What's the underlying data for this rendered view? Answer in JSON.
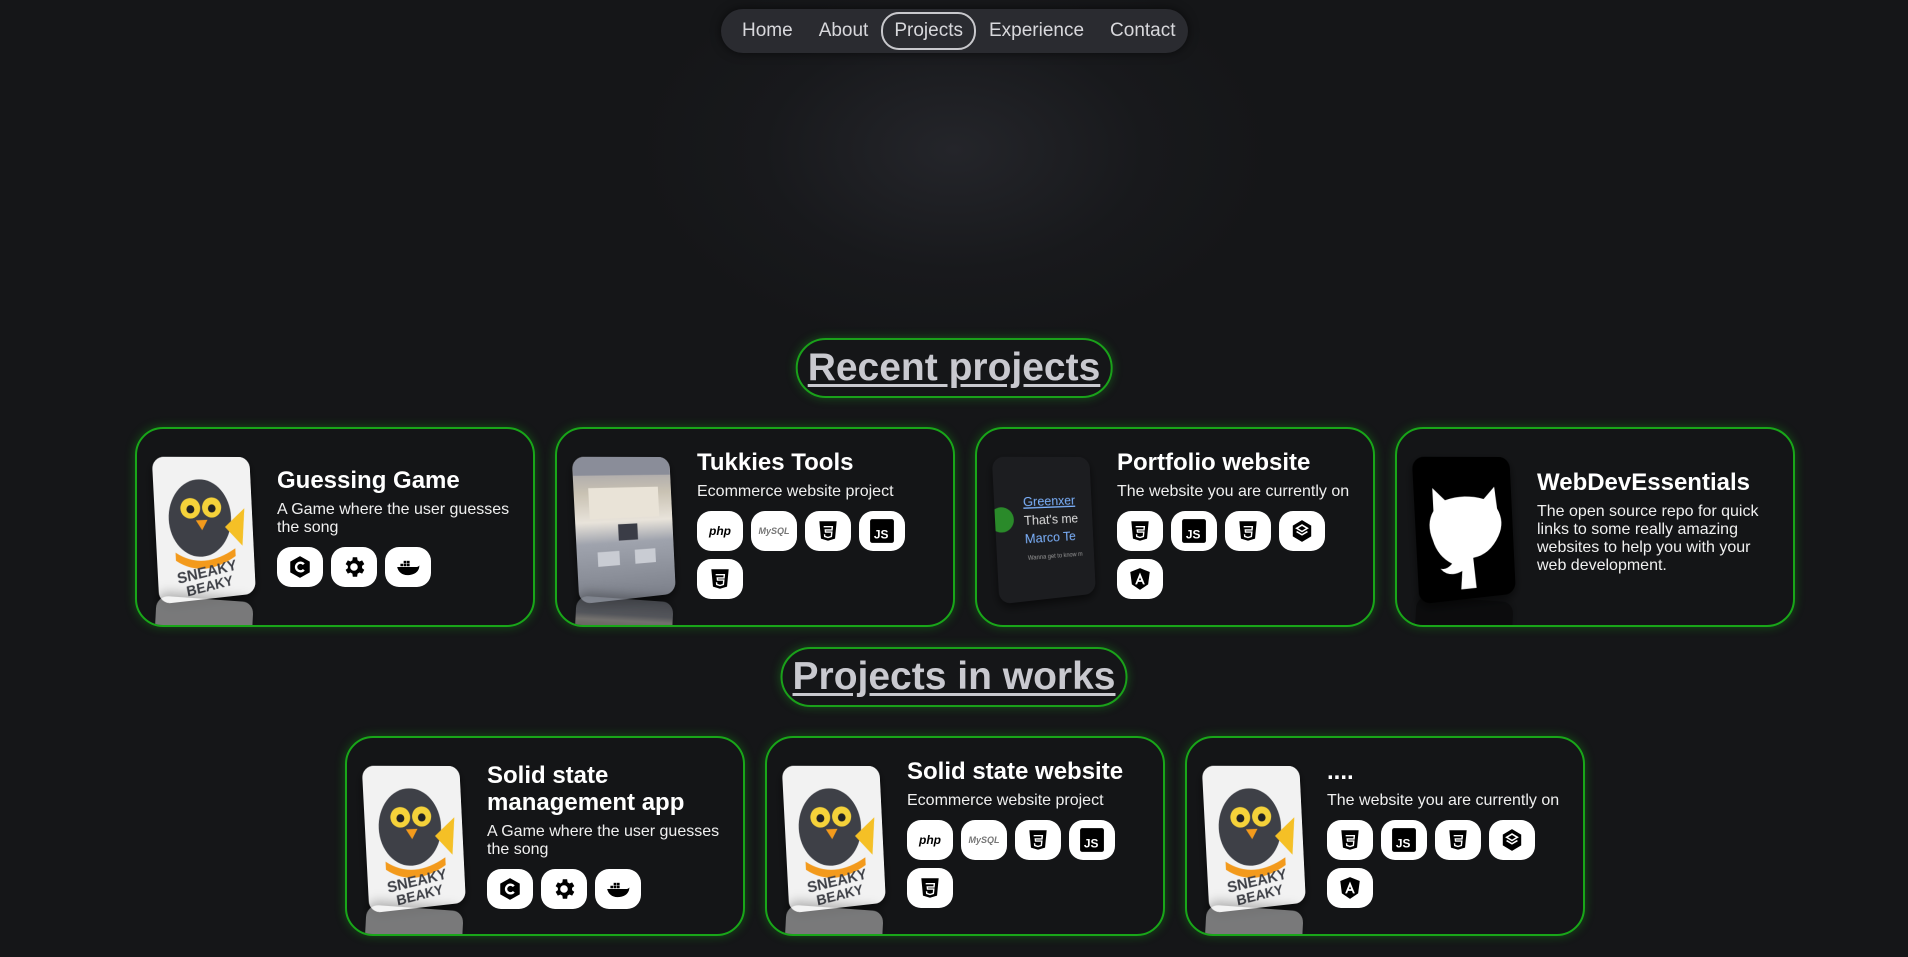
{
  "nav": {
    "items": [
      {
        "label": "Home"
      },
      {
        "label": "About"
      },
      {
        "label": "Projects",
        "active": true
      },
      {
        "label": "Experience"
      },
      {
        "label": "Contact"
      }
    ]
  },
  "sections": {
    "recent_title": "Recent projects",
    "works_title": "Projects in works"
  },
  "recent_projects": [
    {
      "title": "Guessing Game",
      "description": "A Game where the user guesses the song",
      "tech": [
        "csharp-icon",
        "gear-icon",
        "docker-icon"
      ],
      "thumb_text": "SNEAKY BEAKY LIKE"
    },
    {
      "title": "Tukkies Tools",
      "description": "Ecommerce website project",
      "tech": [
        "php-icon",
        "mysql-icon",
        "css3-icon",
        "js-icon",
        "html5-icon"
      ],
      "thumb_text": "Welcome to Tukkies Tools — tools you need for your past find your stuff?"
    },
    {
      "title": "Portfolio website",
      "description": "The website you are currently on",
      "tech": [
        "css3-icon",
        "js-icon",
        "html5-icon",
        "ionic-icon",
        "angular-icon"
      ],
      "thumb_text": "Greenxer That's me Marco Te Wanna get to know m"
    },
    {
      "title": "WebDevEssentials",
      "description": "The open source repo for quick links to some really amazing websites to help you with your web development.",
      "tech": [],
      "thumb_text": ""
    }
  ],
  "works_projects": [
    {
      "title": "Solid state management app",
      "description": "A Game where the user guesses the song",
      "tech": [
        "csharp-icon",
        "gear-icon",
        "docker-icon"
      ],
      "thumb_text": "SNEAKY BEAKY LIKE"
    },
    {
      "title": "Solid state website",
      "description": "Ecommerce website project",
      "tech": [
        "php-icon",
        "mysql-icon",
        "css3-icon",
        "js-icon",
        "html5-icon"
      ],
      "thumb_text": "SNEAKY BEAKY LIKE"
    },
    {
      "title": "....",
      "description": "The website you are currently on",
      "tech": [
        "css3-icon",
        "js-icon",
        "html5-icon",
        "ionic-icon",
        "angular-icon"
      ],
      "thumb_text": "SNEAKY BEAKY LIKE"
    }
  ],
  "tech_labels": {
    "php": "php",
    "mysql": "MySQL",
    "js": "JS",
    "css": "CSS",
    "html": "HTML"
  }
}
